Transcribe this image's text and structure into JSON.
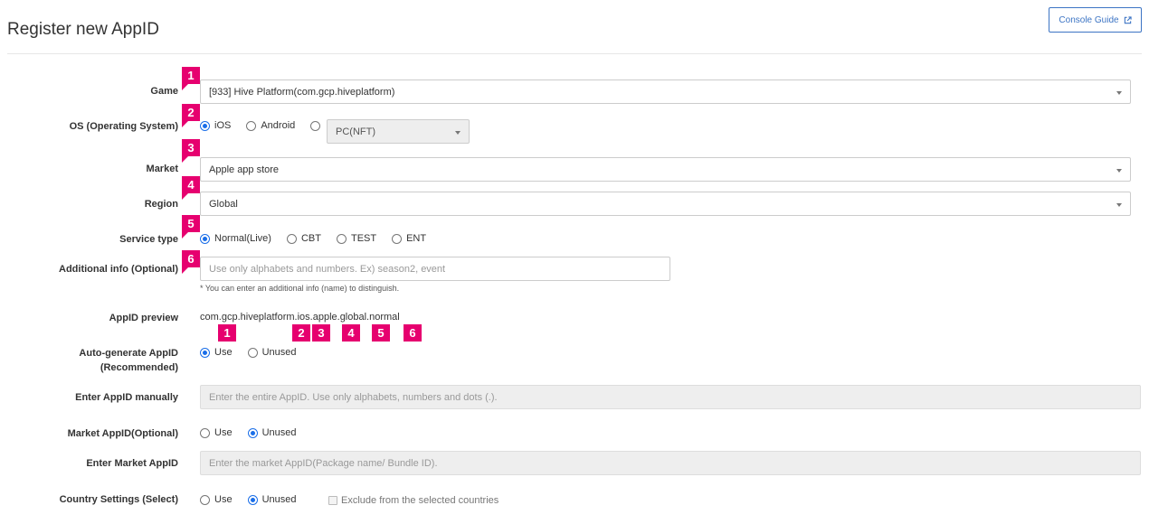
{
  "header": {
    "title": "Register new AppID",
    "console_guide_label": "Console Guide"
  },
  "game": {
    "label": "Game",
    "value": "[933] Hive Platform(com.gcp.hiveplatform)"
  },
  "os": {
    "label": "OS (Operating System)",
    "options": [
      "iOS",
      "Android"
    ],
    "selected": "iOS",
    "pc_select_value": "PC(NFT)"
  },
  "market": {
    "label": "Market",
    "value": "Apple app store"
  },
  "region": {
    "label": "Region",
    "value": "Global"
  },
  "service_type": {
    "label": "Service type",
    "options": [
      "Normal(Live)",
      "CBT",
      "TEST",
      "ENT"
    ],
    "selected": "Normal(Live)"
  },
  "additional_info": {
    "label": "Additional info (Optional)",
    "placeholder": "Use only alphabets and numbers. Ex) season2, event",
    "hint": "* You can enter an additional info (name) to distinguish."
  },
  "appid_preview": {
    "label": "AppID preview",
    "value": "com.gcp.hiveplatform.ios.apple.global.normal"
  },
  "auto_generate": {
    "label": "Auto-generate AppID (Recommended)",
    "options": [
      "Use",
      "Unused"
    ],
    "selected": "Use"
  },
  "manual_appid": {
    "label": "Enter AppID manually",
    "placeholder": "Enter the entire AppID. Use only alphabets, numbers and dots (.)."
  },
  "market_appid": {
    "label": "Market AppID(Optional)",
    "options": [
      "Use",
      "Unused"
    ],
    "selected": "Unused"
  },
  "enter_market_appid": {
    "label": "Enter Market AppID",
    "placeholder": "Enter the market AppID(Package name/ Bundle ID)."
  },
  "country_settings": {
    "label": "Country Settings (Select)",
    "options": [
      "Use",
      "Unused"
    ],
    "selected": "Unused",
    "exclude_label": "Exclude from the selected countries"
  },
  "annotation_badges": [
    "1",
    "2",
    "3",
    "4",
    "5",
    "6"
  ],
  "colors": {
    "badge": "#e6006f",
    "accent": "#1a6ee8",
    "guide_button": "#3c74c4"
  }
}
